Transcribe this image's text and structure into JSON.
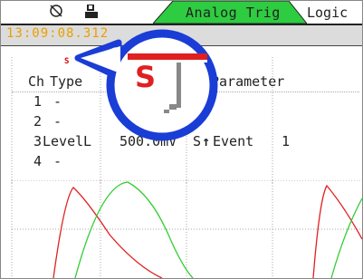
{
  "header": {
    "icons": [
      "power-icon",
      "sd-card-icon"
    ],
    "active_tab": "Analog Trig",
    "next_tab": "Logic"
  },
  "timebar": {
    "time": "13:09:08.312"
  },
  "table": {
    "header_ch": "Ch",
    "header_type": "Type",
    "header_parameter": "Parameter",
    "rows": [
      {
        "ch": "1",
        "type": "-"
      },
      {
        "ch": "2",
        "type": "-"
      },
      {
        "ch": "3",
        "type": "Level",
        "sub": "L",
        "value": "500.0mV",
        "slope": "S",
        "arrow": "↑",
        "mode": "Event",
        "count": "1"
      },
      {
        "ch": "4",
        "type": "-"
      }
    ],
    "marker": "S"
  },
  "colors": {
    "tab_green": "#2ecc40",
    "callout_blue": "#1a3dd6",
    "wave_red": "#e02020",
    "wave_green": "#33cc33",
    "time_orange": "#e8a000"
  }
}
